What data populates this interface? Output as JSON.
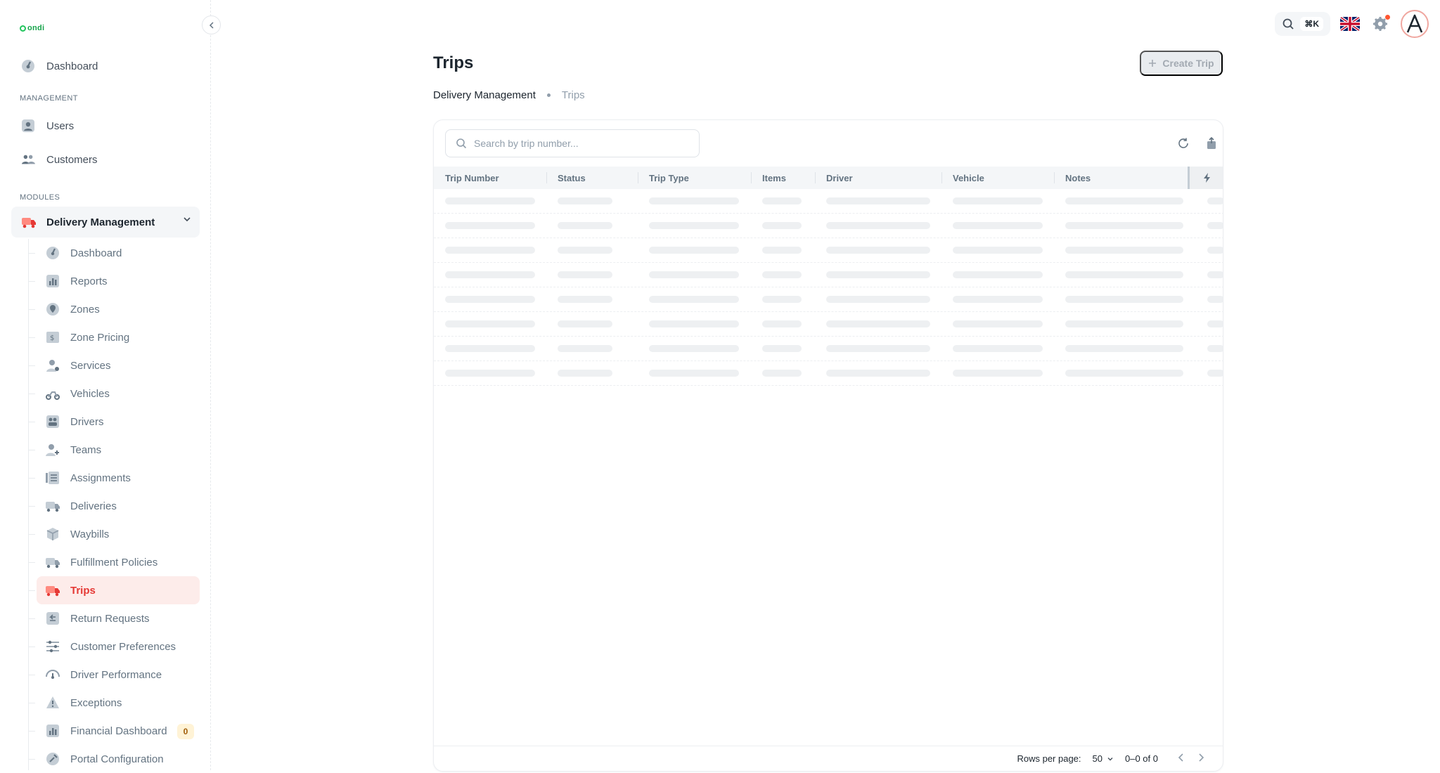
{
  "app": {
    "logo_text": "ondi"
  },
  "nav": {
    "dashboard": "Dashboard",
    "management_label": "MANAGEMENT",
    "users": "Users",
    "customers": "Customers",
    "modules_label": "MODULES",
    "module_head": "Delivery Management",
    "sub_items": [
      {
        "label": "Dashboard",
        "icon": "dashboard-icon"
      },
      {
        "label": "Reports",
        "icon": "reports-icon"
      },
      {
        "label": "Zones",
        "icon": "zones-icon"
      },
      {
        "label": "Zone Pricing",
        "icon": "pricing-icon"
      },
      {
        "label": "Services",
        "icon": "services-icon"
      },
      {
        "label": "Vehicles",
        "icon": "vehicles-icon"
      },
      {
        "label": "Drivers",
        "icon": "drivers-icon"
      },
      {
        "label": "Teams",
        "icon": "teams-icon"
      },
      {
        "label": "Assignments",
        "icon": "assignments-icon"
      },
      {
        "label": "Deliveries",
        "icon": "deliveries-icon"
      },
      {
        "label": "Waybills",
        "icon": "waybills-icon"
      },
      {
        "label": "Fulfillment Policies",
        "icon": "policies-icon"
      },
      {
        "label": "Trips",
        "icon": "trips-icon",
        "active": true
      },
      {
        "label": "Return Requests",
        "icon": "returns-icon"
      },
      {
        "label": "Customer Preferences",
        "icon": "preferences-icon"
      },
      {
        "label": "Driver Performance",
        "icon": "performance-icon"
      },
      {
        "label": "Exceptions",
        "icon": "exceptions-icon"
      },
      {
        "label": "Financial Dashboard",
        "icon": "financial-icon",
        "badge": "0"
      },
      {
        "label": "Portal Configuration",
        "icon": "portal-icon"
      }
    ]
  },
  "topbar": {
    "shortcut": "⌘K"
  },
  "page": {
    "title": "Trips",
    "create_label": "Create Trip",
    "breadcrumb": [
      "Delivery Management",
      "Trips"
    ]
  },
  "table": {
    "search_placeholder": "Search by trip number...",
    "columns": [
      "Trip Number",
      "Status",
      "Trip Type",
      "Items",
      "Driver",
      "Vehicle",
      "Notes"
    ],
    "skeleton_rows": 8,
    "rows_per_page_label": "Rows per page:",
    "rows_per_page": "50",
    "range": "0–0 of 0"
  },
  "colors": {
    "accent": "#e53935",
    "active_bg": "#fdecea",
    "badge_bg": "#fff3d6"
  }
}
